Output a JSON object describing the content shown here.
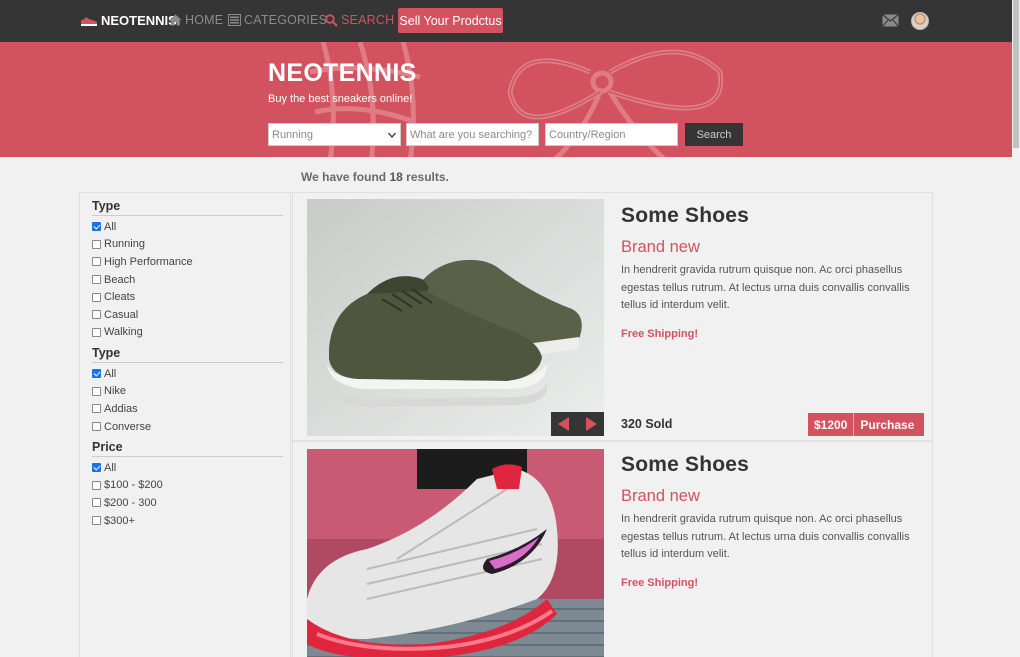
{
  "nav": {
    "brand": "NEOTENNIS",
    "home": "HOME",
    "categories": "CATEGORIES",
    "search": "SEARCH",
    "sell": "Sell Your Prodctus"
  },
  "hero": {
    "title": "NEOTENNIS",
    "subtitle": "Buy the best sneakers online!",
    "category_selected": "Running",
    "keyword_placeholder": "What are you searching?",
    "country_placeholder": "Country/Region",
    "search_button": "Search"
  },
  "results": {
    "prefix": "We have found",
    "count": "18",
    "suffix": "results."
  },
  "filters": [
    {
      "title": "Type",
      "options": [
        {
          "label": "All",
          "checked": true
        },
        {
          "label": "Running",
          "checked": false
        },
        {
          "label": "High Performance",
          "checked": false
        },
        {
          "label": "Beach",
          "checked": false
        },
        {
          "label": "Cleats",
          "checked": false
        },
        {
          "label": "Casual",
          "checked": false
        },
        {
          "label": "Walking",
          "checked": false
        }
      ]
    },
    {
      "title": "Type",
      "options": [
        {
          "label": "All",
          "checked": true
        },
        {
          "label": "Nike",
          "checked": false
        },
        {
          "label": "Addias",
          "checked": false
        },
        {
          "label": "Converse",
          "checked": false
        }
      ]
    },
    {
      "title": "Price",
      "options": [
        {
          "label": "All",
          "checked": true
        },
        {
          "label": "$100 - $200",
          "checked": false
        },
        {
          "label": "$200 - 300",
          "checked": false
        },
        {
          "label": "$300+",
          "checked": false
        }
      ]
    }
  ],
  "products": [
    {
      "name": "Some Shoes",
      "condition": "Brand new",
      "description": "In hendrerit gravida rutrum quisque non. Ac orci phasellus egestas tellus rutrum. At lectus urna duis convallis convallis tellus id interdum velit.",
      "shipping": "Free Shipping!",
      "sold": "320 Sold",
      "price": "$1200",
      "purchase": "Purchase"
    },
    {
      "name": "Some Shoes",
      "condition": "Brand new",
      "description": "In hendrerit gravida rutrum quisque non. Ac orci phasellus egestas tellus rutrum. At lectus urna duis convallis convallis tellus id interdum velit.",
      "shipping": "Free Shipping!"
    }
  ],
  "colors": {
    "accent": "#d2535f",
    "nav_bg": "#353535",
    "page_bg": "#f1f1f1"
  },
  "icons": [
    "sneaker-logo-icon",
    "home-icon",
    "categories-icon",
    "search-icon",
    "mail-icon",
    "avatar",
    "arrow-left-icon",
    "arrow-right-icon"
  ]
}
